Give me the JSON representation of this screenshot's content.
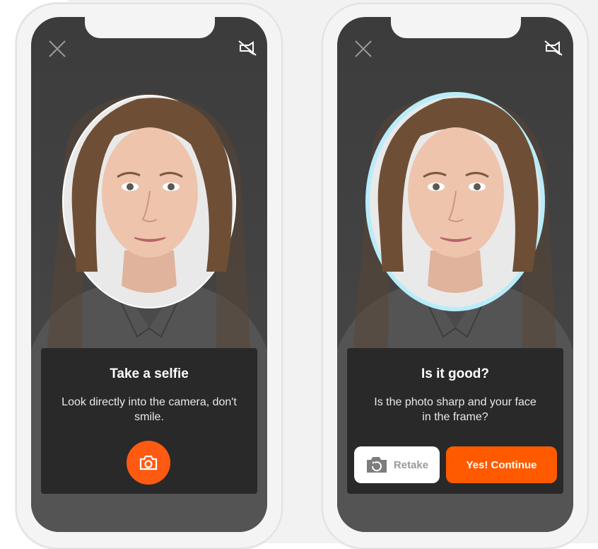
{
  "screen_one": {
    "title": "Take a selfie",
    "instruction": "Look directly into the camera, don't smile.",
    "icons": {
      "close": "close-icon",
      "flash_off": "flash-off-icon",
      "capture": "camera-icon"
    },
    "oval_outline_color": "#ffffff"
  },
  "screen_two": {
    "title": "Is it good?",
    "question": "Is the photo sharp and your face in the frame?",
    "retake_label": "Retake",
    "continue_label": "Yes! Continue",
    "icons": {
      "close": "close-icon",
      "flash_off": "flash-off-icon",
      "retake": "retake-camera-icon"
    },
    "oval_outline_color": "#b8ecfb"
  },
  "colors": {
    "accent": "#ff5a00",
    "card_bg": "#262626",
    "screen_bg": "#3f3f3f"
  }
}
